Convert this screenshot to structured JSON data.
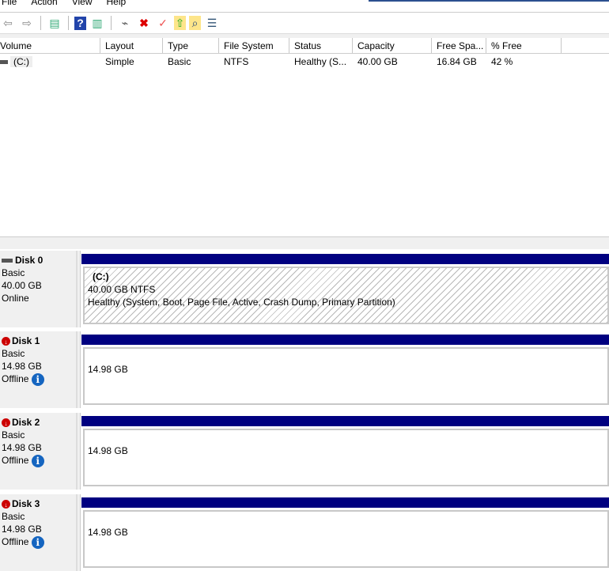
{
  "menu": [
    "File",
    "Action",
    "View",
    "Help"
  ],
  "toolbar": [
    {
      "icon": "back-icon",
      "glyph": "⇦"
    },
    {
      "icon": "forward-icon",
      "glyph": "⇨"
    },
    {
      "icon": "show-hide-tree-icon",
      "glyph": "▤"
    },
    {
      "icon": "help-icon",
      "glyph": "?"
    },
    {
      "icon": "show-action-pane-icon",
      "glyph": "▥"
    },
    {
      "icon": "connect-disk-icon",
      "glyph": "⌁"
    },
    {
      "icon": "delete-icon",
      "glyph": "✖"
    },
    {
      "icon": "properties-icon",
      "glyph": "✓"
    },
    {
      "icon": "export-icon",
      "glyph": "⇧"
    },
    {
      "icon": "search-icon",
      "glyph": "⌕"
    },
    {
      "icon": "list-icon",
      "glyph": "☰"
    }
  ],
  "columns": [
    "Volume",
    "Layout",
    "Type",
    "File System",
    "Status",
    "Capacity",
    "Free Spa...",
    "% Free",
    ""
  ],
  "volumes": [
    {
      "Volume": "(C:)",
      "Layout": "Simple",
      "Type": "Basic",
      "File System": "NTFS",
      "Status": "Healthy (S...",
      "Capacity": "40.00 GB",
      "Free Space": "16.84 GB",
      "% Free": "42 %"
    }
  ],
  "disks": [
    {
      "name": "Disk 0",
      "type": "Basic",
      "size": "40.00 GB",
      "status": "Online",
      "partition": {
        "label": "(C:)",
        "size": "40.00 GB NTFS",
        "status": "Healthy (System, Boot, Page File, Active, Crash Dump, Primary Partition)"
      }
    },
    {
      "name": "Disk 1",
      "type": "Basic",
      "size": "14.98 GB",
      "status": "Offline",
      "unallocated": "14.98 GB"
    },
    {
      "name": "Disk 2",
      "type": "Basic",
      "size": "14.98 GB",
      "status": "Offline",
      "unallocated": "14.98 GB"
    },
    {
      "name": "Disk 3",
      "type": "Basic",
      "size": "14.98 GB",
      "status": "Offline",
      "unallocated": "14.98 GB"
    }
  ],
  "colors": {
    "disk_bar": "#000080",
    "info": "#1565c0",
    "offline": "#cc0000"
  }
}
